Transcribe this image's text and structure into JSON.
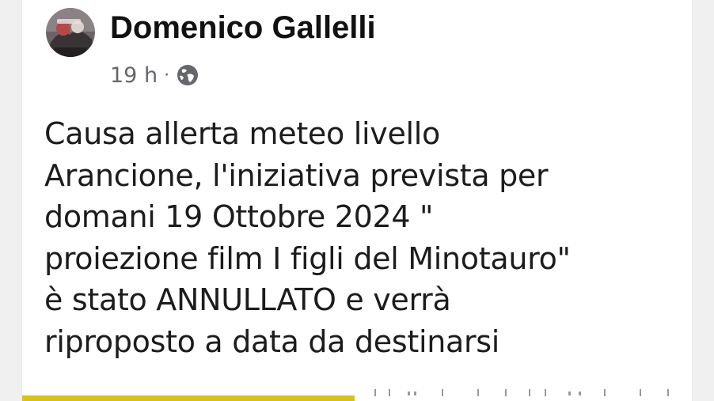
{
  "post": {
    "author": "Domenico Gallelli",
    "time": "19 h",
    "separator": "·",
    "privacy_icon": "globe-icon",
    "text_lines": [
      "Causa allerta meteo livello",
      "Arancione, l'iniziativa prevista per",
      "domani 19 Ottobre 2024 \"",
      "proiezione film I figli del Minotauro\"",
      "è stato ANNULLATO e verrà",
      "riproposto a data da destinarsi"
    ]
  },
  "colors": {
    "author_text": "#111111",
    "meta_text": "#65676b",
    "body_text": "#1c1c1c",
    "accent_bar": "#d8c21a"
  }
}
